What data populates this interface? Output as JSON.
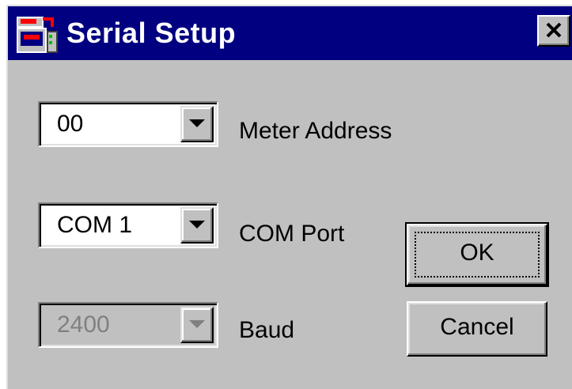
{
  "window": {
    "title": "Serial Setup",
    "icon": "serial-port-app-icon",
    "close_icon": "close-x-icon"
  },
  "fields": {
    "meter_address": {
      "value": "00",
      "label": "Meter Address"
    },
    "com_port": {
      "value": "COM 1",
      "label": "COM Port"
    },
    "baud": {
      "value": "2400",
      "label": "Baud",
      "disabled": true
    }
  },
  "buttons": {
    "ok": "OK",
    "cancel": "Cancel"
  },
  "colors": {
    "titlebar": "#000080",
    "face": "#c0c0c0",
    "disabled_text": "#808080"
  }
}
